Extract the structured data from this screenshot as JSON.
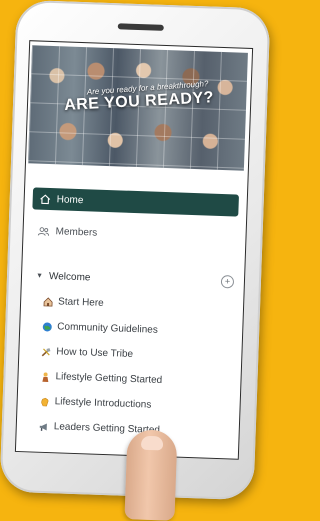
{
  "hero": {
    "tagline": "Are you ready for a breakthrough?",
    "title": "ARE YOU READY?"
  },
  "nav": {
    "items": [
      {
        "label": "Home",
        "icon": "home-icon",
        "active": true
      },
      {
        "label": "Members",
        "icon": "members-icon",
        "active": false
      }
    ]
  },
  "section": {
    "title": "Welcome"
  },
  "channels": [
    {
      "label": "Start Here",
      "icon": "house-emoji-icon"
    },
    {
      "label": "Community Guidelines",
      "icon": "globe-emoji-icon"
    },
    {
      "label": "How to Use Tribe",
      "icon": "tools-emoji-icon"
    },
    {
      "label": "Lifestyle Getting Started",
      "icon": "person-emoji-icon"
    },
    {
      "label": "Lifestyle Introductions",
      "icon": "wave-hand-emoji-icon"
    },
    {
      "label": "Leaders Getting Started",
      "icon": "megaphone-emoji-icon"
    }
  ],
  "colors": {
    "background": "#f6b40f",
    "active_nav": "#1f4a45"
  }
}
